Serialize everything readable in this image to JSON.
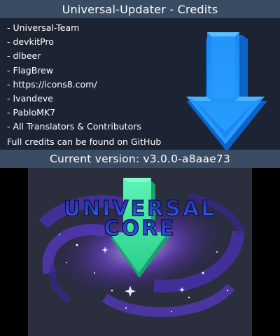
{
  "top_screen": {
    "title": "Universal-Updater - Credits",
    "credits": [
      "- Universal-Team",
      "- devkitPro",
      "- dlbeer",
      "- FlagBrew",
      "- https://icons8.com/",
      "- Ivandeve",
      "- PabloMK7",
      "- All Translators & Contributors"
    ],
    "full_credits_note": "Full credits can be found on GitHub",
    "version_label": "Current version: v3.0.0-a8aae73",
    "icon": "download-arrow-icon"
  },
  "bottom_screen": {
    "logo_line1": "UNIVERSAL",
    "logo_line2": "CORE",
    "icon": "galaxy-download-arrow-icon"
  },
  "colors": {
    "title_bar": "#3a4c64",
    "content_bg": "#1c2433",
    "arrow_blue": "#1e8fff",
    "arrow_green": "#3ee8a0",
    "logo_blue": "#2a4eff",
    "splash_bg": "#2b2f3d"
  }
}
